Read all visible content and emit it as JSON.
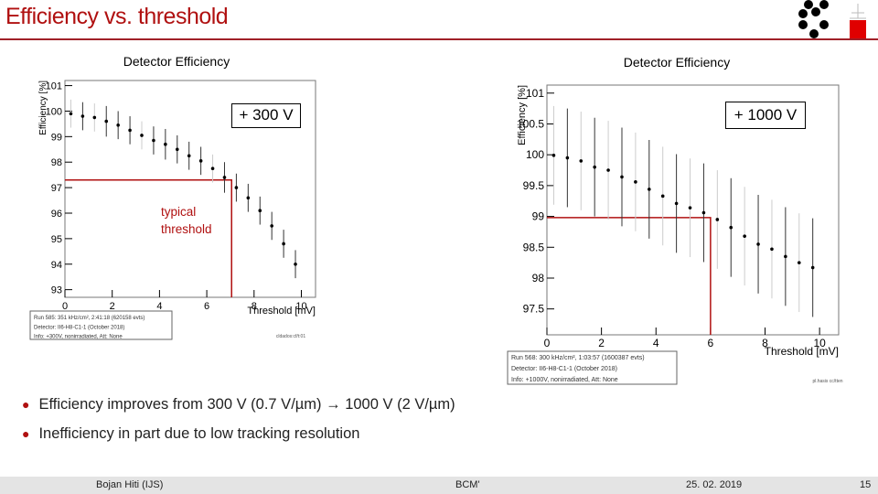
{
  "slide": {
    "title": "Efficiency vs. threshold",
    "bullets": [
      "Efficiency improves from 300 V (0.7 V/µm) → 1000 V (2 V/µm)",
      "Inefficiency in part due to low tracking resolution"
    ],
    "footer": {
      "author": "Bojan Hiti (IJS)",
      "event": "BCM'",
      "date": "25. 02. 2019",
      "page": "15"
    },
    "accent_color": "#b01010"
  },
  "annotations": {
    "left_label": "+ 300 V",
    "right_label": "+ 1000 V",
    "typical_threshold": [
      "typical",
      "threshold"
    ]
  },
  "chart_data": [
    {
      "type": "scatter",
      "title": "Detector Efficiency",
      "xlabel": "Threshold [mV]",
      "ylabel": "Efficiency [%]",
      "xlim": [
        0,
        10.6
      ],
      "ylim": [
        92.7,
        101.2
      ],
      "xticks": [
        0,
        2,
        4,
        6,
        8,
        10
      ],
      "yticks": [
        93,
        94,
        95,
        96,
        97,
        98,
        99,
        100,
        101
      ],
      "grid": false,
      "x": [
        0.25,
        0.75,
        1.25,
        1.75,
        2.25,
        2.75,
        3.25,
        3.75,
        4.25,
        4.75,
        5.25,
        5.75,
        6.25,
        6.75,
        7.25,
        7.75,
        8.25,
        8.75,
        9.25,
        9.75
      ],
      "y": [
        99.9,
        99.8,
        99.75,
        99.6,
        99.45,
        99.25,
        99.05,
        98.85,
        98.7,
        98.5,
        98.25,
        98.05,
        97.75,
        97.4,
        97.0,
        96.6,
        96.1,
        95.5,
        94.8,
        94.0
      ],
      "yerr": [
        0.55,
        0.55,
        0.55,
        0.6,
        0.55,
        0.55,
        0.55,
        0.55,
        0.6,
        0.55,
        0.55,
        0.55,
        0.55,
        0.6,
        0.55,
        0.55,
        0.55,
        0.55,
        0.55,
        0.55
      ],
      "threshold_marker": {
        "x": 7.05,
        "y": 97.3,
        "color": "#b01010"
      },
      "legend": [
        "Run 585: 351 kHz/cm², 2:41:18 (620158 evts)",
        "Detector: II6-H8-C1-1 (October 2018)",
        "Info: +300V, nonirradiated, Att: None"
      ],
      "footnote": "cldados:cf/t:01"
    },
    {
      "type": "scatter",
      "title": "Detector Efficiency",
      "xlabel": "Threshold [mV]",
      "ylabel": "Efficiency [%]",
      "xlim": [
        0,
        10.7
      ],
      "ylim": [
        97.08,
        101.13
      ],
      "xticks": [
        0,
        2,
        4,
        6,
        8,
        10
      ],
      "yticks": [
        97.5,
        98,
        98.5,
        99,
        99.5,
        100,
        100.5,
        101
      ],
      "grid": false,
      "x": [
        0.25,
        0.75,
        1.25,
        1.75,
        2.25,
        2.75,
        3.25,
        3.75,
        4.25,
        4.75,
        5.25,
        5.75,
        6.25,
        6.75,
        7.25,
        7.75,
        8.25,
        8.75,
        9.25,
        9.75
      ],
      "y": [
        99.99,
        99.95,
        99.9,
        99.8,
        99.75,
        99.64,
        99.56,
        99.44,
        99.33,
        99.21,
        99.14,
        99.06,
        98.95,
        98.82,
        98.68,
        98.55,
        98.47,
        98.35,
        98.25,
        98.17
      ],
      "yerr": [
        0.8,
        0.8,
        0.8,
        0.8,
        0.8,
        0.8,
        0.8,
        0.8,
        0.8,
        0.8,
        0.8,
        0.8,
        0.8,
        0.8,
        0.8,
        0.8,
        0.8,
        0.8,
        0.8,
        0.8
      ],
      "threshold_marker": {
        "x": 6.0,
        "y": 98.98,
        "color": "#b01010"
      },
      "legend": [
        "Run 568: 300 kHz/cm², 1:03:57 (1600387 evts)",
        "Detector: II6-H8-C1-1 (October 2018)",
        "Info: +1000V, nonirradiated, Att: None"
      ],
      "footnote": "pl.hasis cc/tten"
    }
  ]
}
